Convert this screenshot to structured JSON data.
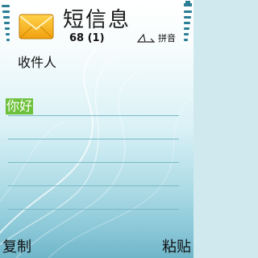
{
  "header": {
    "title": "短信息",
    "counter": "68 (1)",
    "input_mode": "拼音"
  },
  "editor": {
    "recipient_label": "收件人",
    "message_text": "你好"
  },
  "softkeys": {
    "left": "复制",
    "right": "粘贴"
  },
  "icons": {
    "app": "message-envelope-icon",
    "mode": "text-mode-icon"
  },
  "colors": {
    "accent_green": "#6dc03a",
    "status_bar": "#2a7f96"
  }
}
